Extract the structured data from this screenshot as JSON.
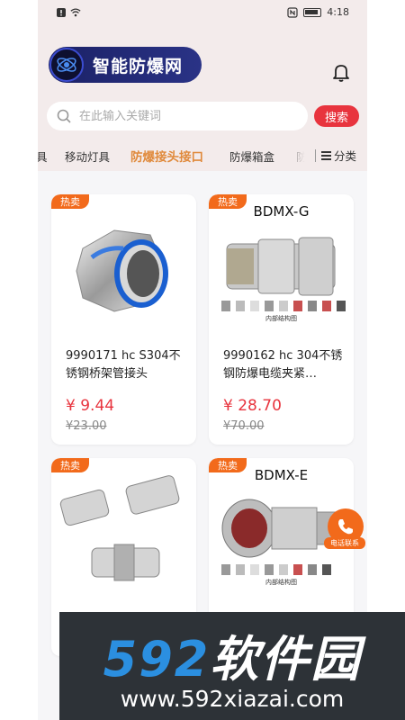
{
  "status_bar": {
    "time": "4:18"
  },
  "header": {
    "logo_text": "智能防爆网"
  },
  "search": {
    "placeholder": "在此输入关键词",
    "button_label": "搜索"
  },
  "tabs": [
    {
      "label": "具"
    },
    {
      "label": "移动灯具"
    },
    {
      "label": "防爆接头接口"
    },
    {
      "label": "防爆箱盒"
    },
    {
      "label": "防"
    }
  ],
  "category_label": "分类",
  "badge_label": "热卖",
  "products": [
    {
      "model": "",
      "name": "9990171 hc S304不锈钢桥架管接头",
      "price": "¥ 9.44",
      "old_price": "¥23.00"
    },
    {
      "model": "BDMX-G",
      "name": "9990162 hc 304不锈钢防爆电缆夹紧…",
      "price": "¥ 28.70",
      "old_price": "¥70.00",
      "caption": "内部结构图"
    },
    {
      "model": "",
      "name": "",
      "price": "",
      "old_price": ""
    },
    {
      "model": "BDMX-E",
      "name": "",
      "price": "",
      "old_price": "",
      "caption": "内部结构图"
    }
  ],
  "float_button": {
    "label": "电话联系"
  },
  "watermark": {
    "numbers": "592",
    "chinese": "软件园",
    "url": "www.592xiazai.com"
  },
  "colors": {
    "accent": "#e8343e",
    "active_tab": "#e08a3c",
    "badge": "#f26a1b",
    "logo_bg": "#1b2166"
  }
}
